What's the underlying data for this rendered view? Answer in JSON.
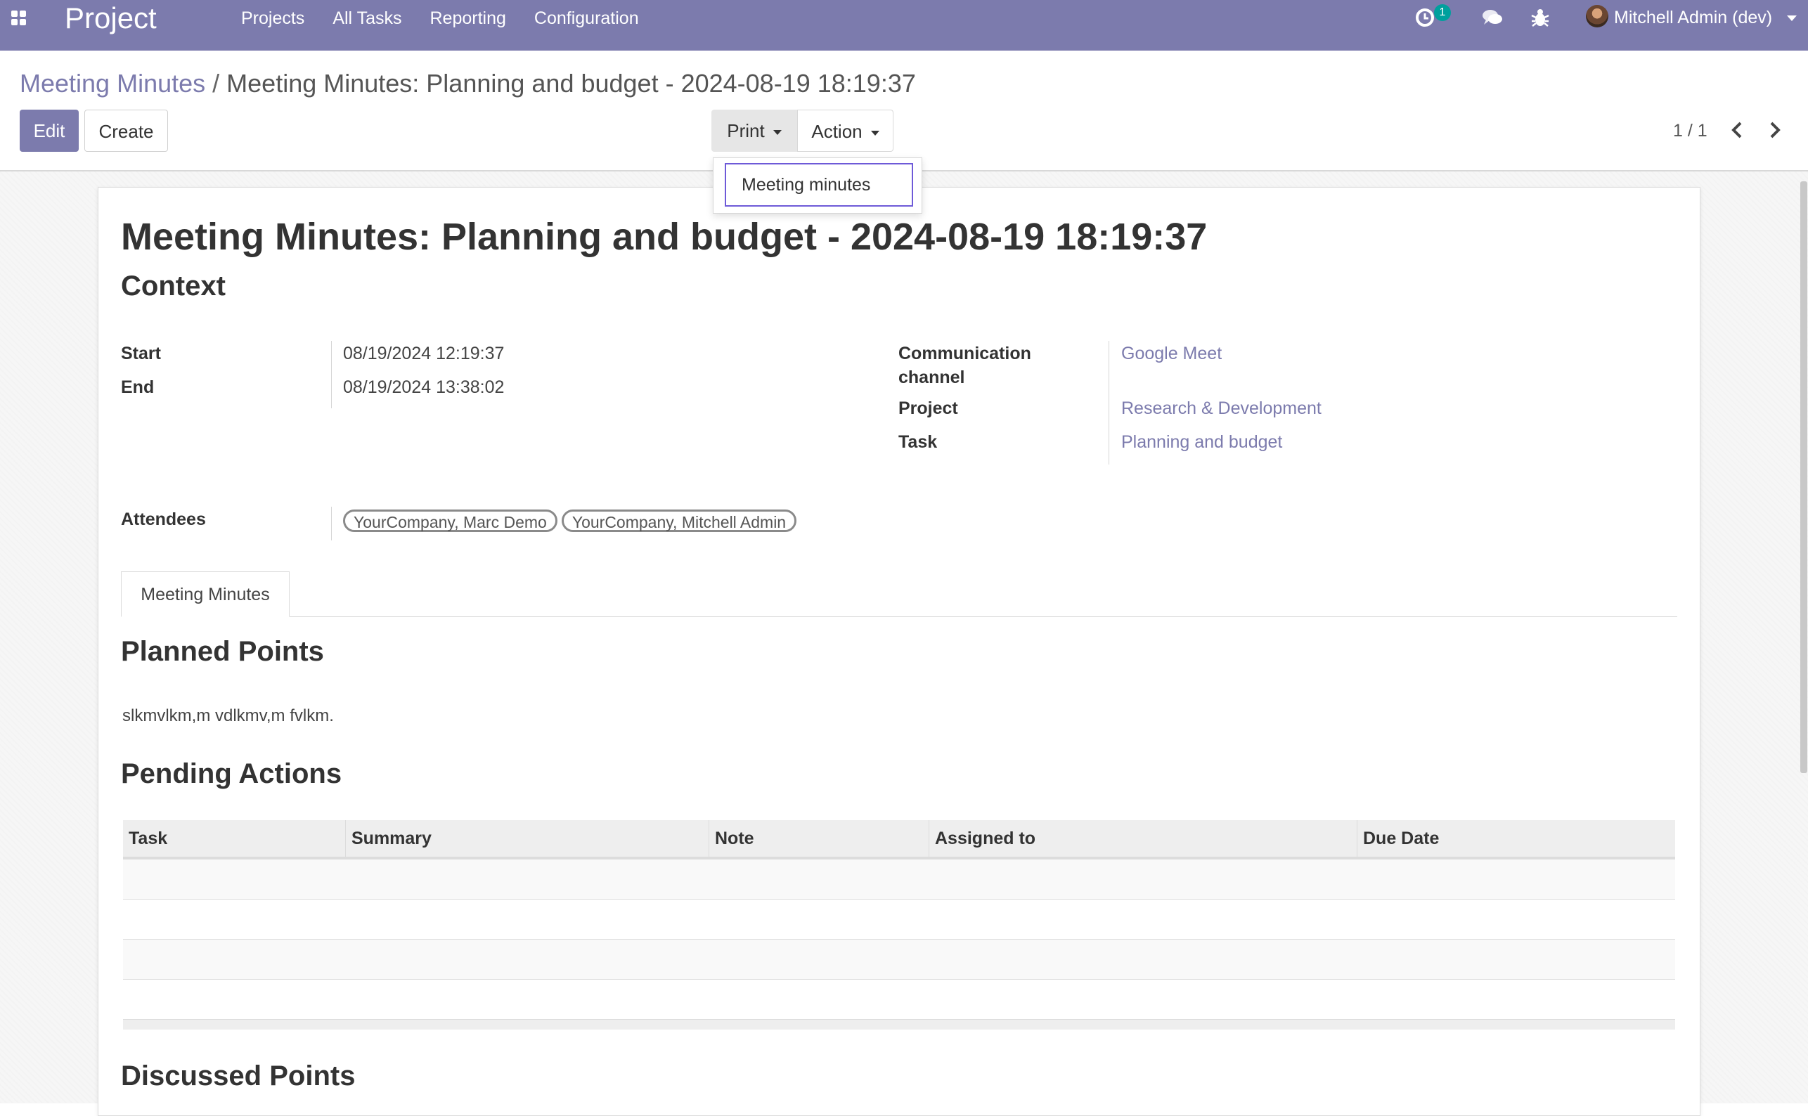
{
  "navbar": {
    "app_title": "Project",
    "menu": [
      "Projects",
      "All Tasks",
      "Reporting",
      "Configuration"
    ],
    "activity_badge": "1",
    "user": "Mitchell Admin (dev)",
    "bg_color": "#7c7bad"
  },
  "breadcrumb": {
    "parent": "Meeting Minutes",
    "separator": "/",
    "current": "Meeting Minutes: Planning and budget - 2024-08-19 18:19:37"
  },
  "toolbar": {
    "edit_label": "Edit",
    "create_label": "Create",
    "print_label": "Print",
    "action_label": "Action",
    "pager": "1 / 1"
  },
  "print_menu": {
    "items": [
      "Meeting minutes"
    ]
  },
  "record": {
    "title": "Meeting Minutes: Planning and budget - 2024-08-19 18:19:37",
    "context_heading": "Context",
    "fields": {
      "start_label": "Start",
      "start_value": "08/19/2024 12:19:37",
      "end_label": "End",
      "end_value": "08/19/2024 13:38:02",
      "channel_label_1": "Communication",
      "channel_label_2": "channel",
      "channel_value": "Google Meet",
      "project_label": "Project",
      "project_value": "Research & Development",
      "task_label": "Task",
      "task_value": "Planning and budget",
      "attendees_label": "Attendees",
      "attendees": [
        "YourCompany, Marc Demo",
        "YourCompany, Mitchell Admin"
      ]
    },
    "tab_label": "Meeting Minutes",
    "planned_heading": "Planned Points",
    "planned_text": "slkmvlkm,m vdlkmv,m fvlkm.",
    "pending_heading": "Pending Actions",
    "pending_columns": [
      "Task",
      "Summary",
      "Note",
      "Assigned to",
      "Due Date"
    ],
    "discussed_heading": "Discussed Points"
  },
  "icons": {
    "apps": "apps-grid-icon",
    "activity": "activity-clock-icon",
    "chat": "chat-bubbles-icon",
    "debug": "bug-icon",
    "pager_prev": "chevron-left-icon",
    "pager_next": "chevron-right-icon"
  }
}
